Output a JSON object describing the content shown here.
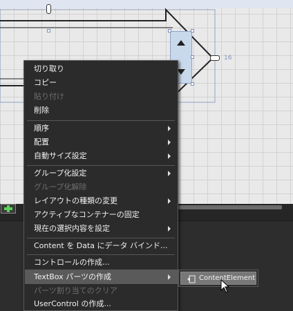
{
  "canvas": {
    "ruler_value": "16",
    "colors": {
      "canvas_bg": "#e9e9e9",
      "selection": "#8ea3c8",
      "menu_bg": "#2b2b2b",
      "highlight": "#5a5a5a"
    }
  },
  "context_menu": {
    "items": [
      {
        "label": "切り取り",
        "enabled": true
      },
      {
        "label": "コピー",
        "enabled": true
      },
      {
        "label": "貼り付け",
        "enabled": false
      },
      {
        "label": "削除",
        "enabled": true
      },
      {
        "label": "順序",
        "enabled": true,
        "submenu": true
      },
      {
        "label": "配置",
        "enabled": true,
        "submenu": true
      },
      {
        "label": "自動サイズ設定",
        "enabled": true,
        "submenu": true
      },
      {
        "label": "グループ化設定",
        "enabled": true,
        "submenu": true
      },
      {
        "label": "グループ化解除",
        "enabled": false
      },
      {
        "label": "レイアウトの種類の変更",
        "enabled": true,
        "submenu": true
      },
      {
        "label": "アクティブなコンテナーの固定",
        "enabled": true
      },
      {
        "label": "現在の選択内容を設定",
        "enabled": true,
        "submenu": true
      },
      {
        "label": "Content を Data にデータ バインド...",
        "enabled": true
      },
      {
        "label": "コントロールの作成...",
        "enabled": true
      },
      {
        "label": "TextBox パーツの作成",
        "enabled": true,
        "submenu": true,
        "highlighted": true
      },
      {
        "label": "パーツ割り当てのクリア",
        "enabled": false
      },
      {
        "label": "UserControl の作成...",
        "enabled": true
      }
    ]
  },
  "submenu": {
    "label": "ContentElement",
    "icon": "content-element-icon"
  }
}
